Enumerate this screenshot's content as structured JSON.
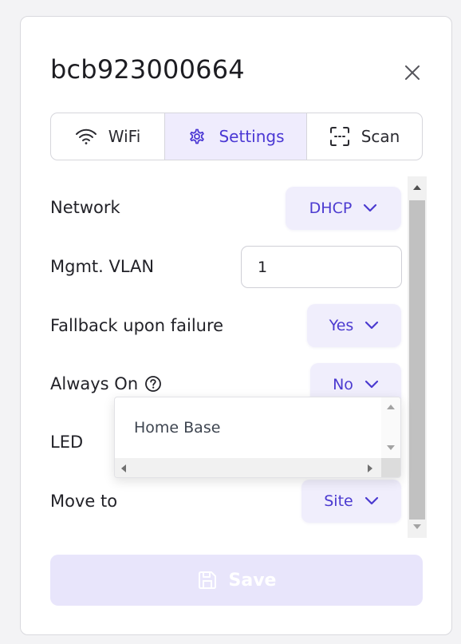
{
  "dialog": {
    "title": "bcb923000664"
  },
  "tabs": [
    {
      "label": "WiFi",
      "icon": "wifi-icon"
    },
    {
      "label": "Settings",
      "icon": "gear-icon",
      "active": true
    },
    {
      "label": "Scan",
      "icon": "scan-icon"
    }
  ],
  "form": {
    "network": {
      "label": "Network",
      "value": "DHCP"
    },
    "vlan": {
      "label": "Mgmt. VLAN",
      "value": "1"
    },
    "fallback": {
      "label": "Fallback upon failure",
      "value": "Yes"
    },
    "always_on": {
      "label": "Always On",
      "value": "No",
      "icon": "help-circle-icon"
    },
    "led": {
      "label": "LED"
    },
    "move_to": {
      "label": "Move to",
      "value": "Site"
    }
  },
  "dropdown": {
    "options": [
      "Home Base"
    ]
  },
  "footer": {
    "save_label": "Save",
    "save_icon": "floppy-disk-icon"
  },
  "colors": {
    "accent": "#4b38d4",
    "accent_bg": "#efecfd",
    "save_disabled_bg": "#e8e5fb"
  }
}
